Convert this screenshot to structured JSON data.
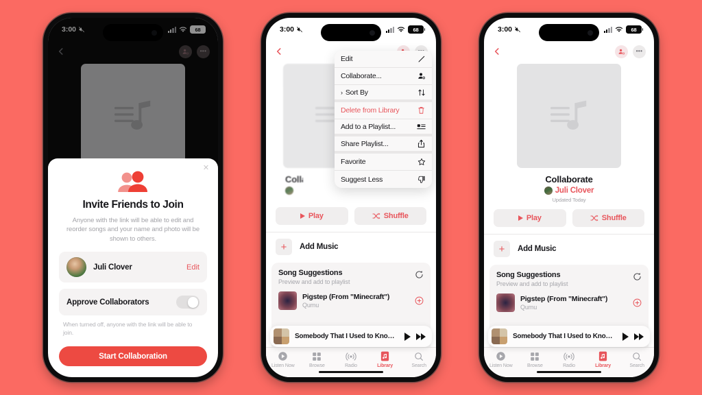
{
  "background_color": "#fb6a62",
  "accent_color": "#e8565c",
  "cta_color": "#ed4a42",
  "status_bar": {
    "time": "3:00",
    "battery": "68",
    "mute_icon": "mute-icon",
    "signal_icon": "cellular-signal-icon",
    "wifi_icon": "wifi-icon"
  },
  "nav_bar": {
    "back_icon": "back-chevron-icon",
    "collaborate_icon": "add-person-icon",
    "more_label": "•••"
  },
  "playlist": {
    "artwork_icon": "playlist-placeholder-icon",
    "title": "Collaborate",
    "owner": "Juli Clover",
    "updated": "Updated Today",
    "play_label": "Play",
    "shuffle_label": "Shuffle",
    "play_icon": "play-triangle-icon",
    "shuffle_icon": "shuffle-icon",
    "add_music_label": "Add Music",
    "add_music_icon": "plus-icon"
  },
  "suggestions": {
    "title": "Song Suggestions",
    "subtitle": "Preview and add to playlist",
    "refresh_icon": "refresh-icon",
    "songs": [
      {
        "name": "Pigstep (From \"Minecraft\")",
        "artist": "Qumu",
        "add_icon": "plus-circle-icon"
      }
    ]
  },
  "now_playing": {
    "title": "Somebody That I Used to Know (...",
    "play_icon": "play-icon",
    "forward_icon": "fast-forward-icon"
  },
  "tab_bar": {
    "items": [
      {
        "label": "Listen Now",
        "icon": "listen-now-icon",
        "active": false
      },
      {
        "label": "Browse",
        "icon": "browse-grid-icon",
        "active": false
      },
      {
        "label": "Radio",
        "icon": "radio-broadcast-icon",
        "active": false
      },
      {
        "label": "Library",
        "icon": "library-icon",
        "active": true
      },
      {
        "label": "Search",
        "icon": "search-icon",
        "active": false
      }
    ]
  },
  "invite_sheet": {
    "close_label": "✕",
    "hero_icon": "two-people-icon",
    "heading": "Invite Friends to Join",
    "description": "Anyone with the link will be able to edit and reorder songs and your name and photo will be shown to others.",
    "person": {
      "name": "Juli Clover",
      "edit_label": "Edit",
      "avatar_icon": "user-avatar"
    },
    "approve": {
      "label": "Approve Collaborators",
      "toggle_state": "off",
      "note": "When turned off, anyone with the link will be able to join."
    },
    "cta_label": "Start Collaboration"
  },
  "context_menu": {
    "items": [
      {
        "label": "Edit",
        "icon": "pencil-icon",
        "danger": false,
        "has_chevron": false,
        "group_end": false
      },
      {
        "label": "Collaborate...",
        "icon": "add-person-icon",
        "danger": false,
        "has_chevron": false,
        "group_end": false
      },
      {
        "label": "Sort By",
        "icon": "sort-arrows-icon",
        "danger": false,
        "has_chevron": true,
        "group_end": true
      },
      {
        "label": "Delete from Library",
        "icon": "trash-icon",
        "danger": true,
        "has_chevron": false,
        "group_end": false
      },
      {
        "label": "Add to a Playlist...",
        "icon": "add-to-playlist-icon",
        "danger": false,
        "has_chevron": false,
        "group_end": true
      },
      {
        "label": "Share Playlist...",
        "icon": "share-icon",
        "danger": false,
        "has_chevron": false,
        "group_end": true
      },
      {
        "label": "Favorite",
        "icon": "star-icon",
        "danger": false,
        "has_chevron": false,
        "group_end": false
      },
      {
        "label": "Suggest Less",
        "icon": "thumbs-down-icon",
        "danger": false,
        "has_chevron": false,
        "group_end": false
      }
    ]
  }
}
